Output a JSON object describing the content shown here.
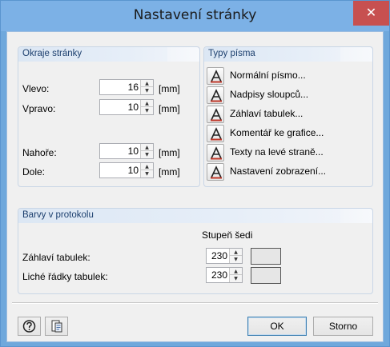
{
  "window": {
    "title": "Nastavení stránky",
    "close_glyph": "✕"
  },
  "margins": {
    "title": "Okraje stránky",
    "rows": [
      {
        "label": "Vlevo:",
        "value": "16",
        "unit": "[mm]"
      },
      {
        "label": "Vpravo:",
        "value": "10",
        "unit": "[mm]"
      },
      {
        "label": "Nahoře:",
        "value": "10",
        "unit": "[mm]"
      },
      {
        "label": "Dole:",
        "value": "10",
        "unit": "[mm]"
      }
    ]
  },
  "fonts": {
    "title": "Typy písma",
    "items": [
      {
        "label": "Normální písmo..."
      },
      {
        "label": "Nadpisy sloupců..."
      },
      {
        "label": "Záhlaví tabulek..."
      },
      {
        "label": "Komentář ke grafice..."
      },
      {
        "label": "Texty na levé straně..."
      },
      {
        "label": "Nastavení zobrazení..."
      }
    ]
  },
  "colors": {
    "title": "Barvy v protokolu",
    "column_header": "Stupeň šedi",
    "rows": [
      {
        "label": "Záhlaví tabulek:",
        "value": "230",
        "swatch": "#e6e6e6"
      },
      {
        "label": "Liché řádky tabulek:",
        "value": "230",
        "swatch": "#e6e6e6"
      }
    ]
  },
  "footer": {
    "ok_label": "OK",
    "cancel_label": "Storno",
    "left_icons": [
      "help-icon",
      "export-settings-icon"
    ]
  },
  "theme": {
    "titlebar": "#7cb1e6",
    "close": "#c75050",
    "group_header": "#dce7f4"
  }
}
